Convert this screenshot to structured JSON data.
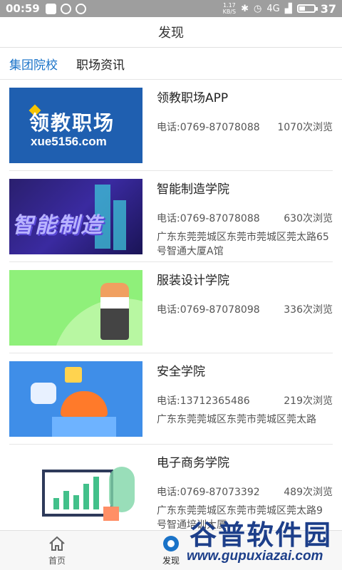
{
  "status_bar": {
    "time": "00:59",
    "net_speed_top": "1.17",
    "net_speed_unit": "KB/S",
    "network": "4G",
    "battery_level": "37",
    "battery_fraction": 0.37
  },
  "header": {
    "title": "发现"
  },
  "tabs": [
    {
      "label": "集团院校",
      "active": true
    },
    {
      "label": "职场资讯",
      "active": false
    }
  ],
  "items": [
    {
      "title": "领教职场APP",
      "phone": "电话:0769-87078088",
      "views": "1070次浏览",
      "address": "",
      "thumb_text": "领教职场",
      "thumb_url": "xue5156.com"
    },
    {
      "title": "智能制造学院",
      "phone": "电话:0769-87078088",
      "views": "630次浏览",
      "address": "广东东莞莞城区东莞市莞城区莞太路65号智通大厦A馆",
      "thumb_text": "智能制造"
    },
    {
      "title": "服装设计学院",
      "phone": "电话:0769-87078098",
      "views": "336次浏览",
      "address": ""
    },
    {
      "title": "安全学院",
      "phone": "电话:13712365486",
      "views": "219次浏览",
      "address": "广东东莞莞城区东莞市莞城区莞太路"
    },
    {
      "title": "电子商务学院",
      "phone": "电话:0769-87073392",
      "views": "489次浏览",
      "address": "广东东莞莞城区东莞市莞城区莞太路9号智通培训大厦"
    }
  ],
  "bottom_nav": [
    {
      "label": "首页",
      "icon": "home-icon"
    },
    {
      "label": "发现",
      "icon": "compass-icon"
    }
  ],
  "watermark": {
    "text": "谷普软件园",
    "url": "www.gupuxiazai.com"
  },
  "colors": {
    "accent": "#1a73c8",
    "status_bar": "#9e9e9e"
  }
}
